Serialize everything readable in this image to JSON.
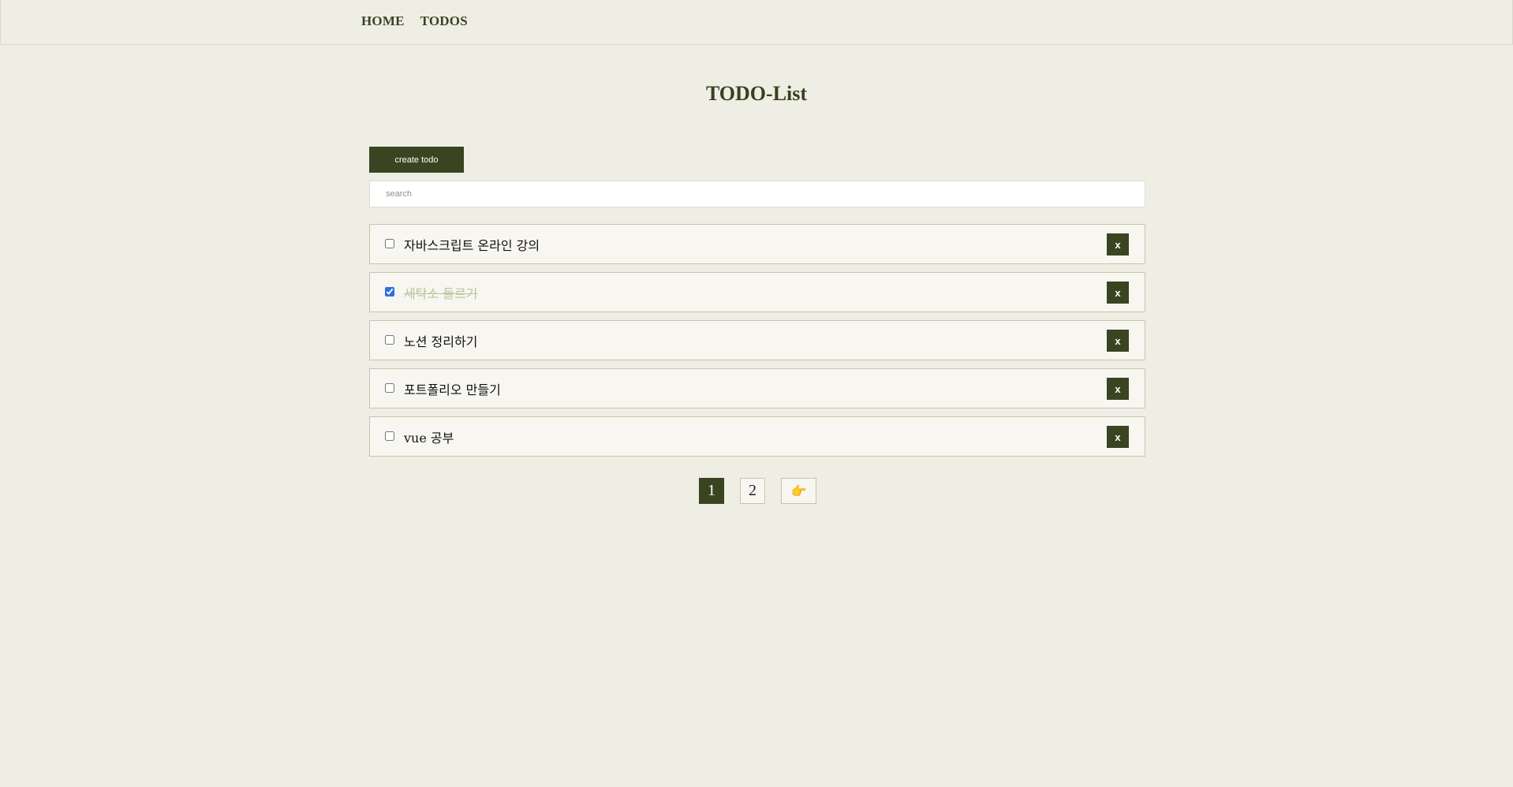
{
  "nav": {
    "home": "HOME",
    "todos": "TODOS"
  },
  "page": {
    "title": "TODO-List"
  },
  "toolbar": {
    "create_label": "create todo"
  },
  "search": {
    "placeholder": "search",
    "value": ""
  },
  "todos": [
    {
      "text": "자바스크립트 온라인 강의",
      "done": false,
      "delete_label": "x"
    },
    {
      "text": "세탁소 들르기",
      "done": true,
      "delete_label": "x"
    },
    {
      "text": "노션 정리하기",
      "done": false,
      "delete_label": "x"
    },
    {
      "text": "포트폴리오 만들기",
      "done": false,
      "delete_label": "x"
    },
    {
      "text": "vue 공부",
      "done": false,
      "delete_label": "x"
    }
  ],
  "pagination": {
    "pages": [
      "1",
      "2"
    ],
    "current": "1",
    "next_icon": "👉"
  },
  "colors": {
    "accent": "#3b4421",
    "background": "#efeee5",
    "checked": "#2f6fde"
  }
}
